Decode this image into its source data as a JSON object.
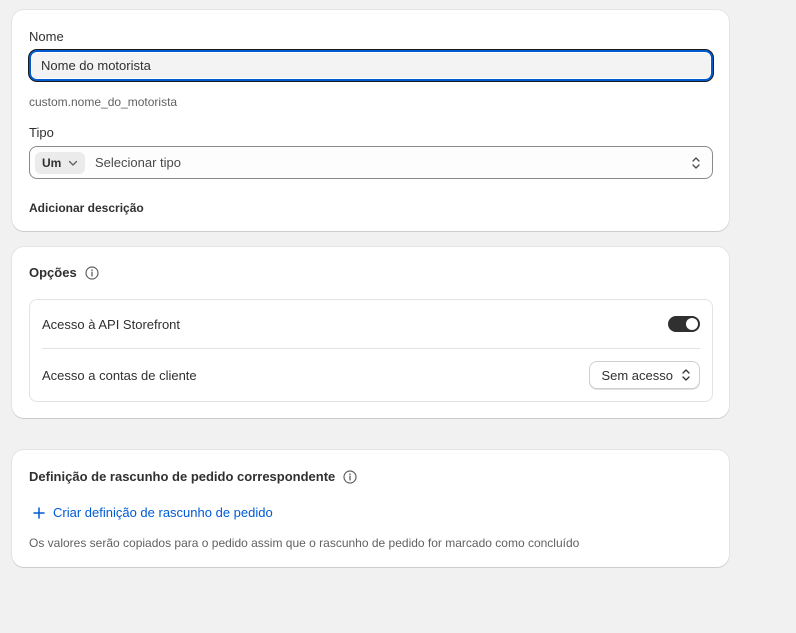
{
  "name_card": {
    "name_label": "Nome",
    "name_value": "Nome do motorista",
    "namespace_key": "custom.nome_do_motorista",
    "type_label": "Tipo",
    "type_chip": "Um",
    "type_placeholder": "Selecionar tipo",
    "add_description": "Adicionar descrição"
  },
  "options_card": {
    "title": "Opções",
    "storefront_label": "Acesso à API Storefront",
    "storefront_enabled": true,
    "customer_access_label": "Acesso a contas de cliente",
    "customer_access_value": "Sem acesso"
  },
  "draft_card": {
    "title": "Definição de rascunho de pedido correspondente",
    "create_link": "Criar definição de rascunho de pedido",
    "note": "Os valores serão copiados para o pedido assim que o rascunho de pedido for marcado como concluído"
  },
  "colors": {
    "focus_blue": "#005bd3",
    "link_blue": "#005bd3",
    "toggle_on": "#303030",
    "page_bg": "#f1f1f1"
  }
}
